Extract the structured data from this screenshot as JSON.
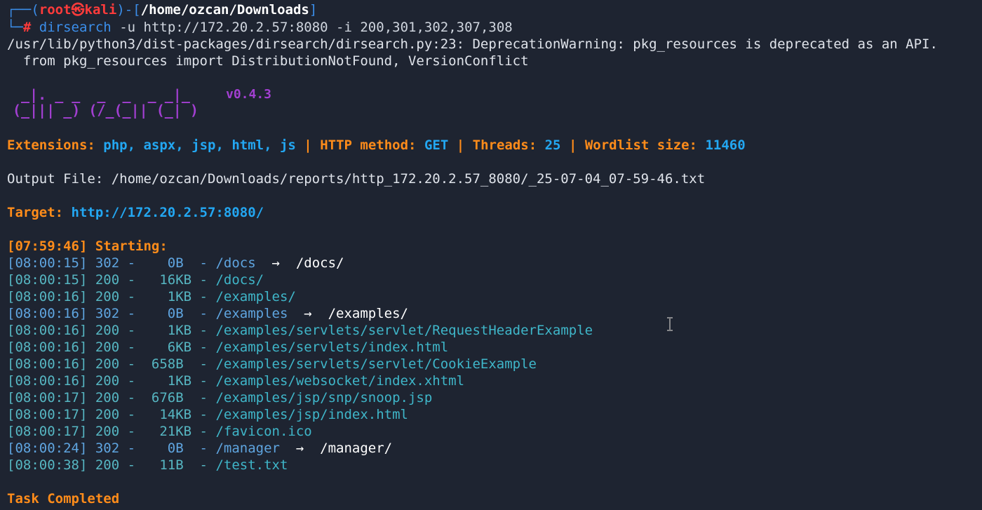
{
  "prompt": {
    "user": "root",
    "host": "kali",
    "cwd": "/home/ozcan/Downloads",
    "command": "dirsearch",
    "args": "-u http://172.20.2.57:8080 -i 200,301,302,307,308"
  },
  "warning": {
    "line1": "/usr/lib/python3/dist-packages/dirsearch/dirsearch.py:23: DeprecationWarning: pkg_resources is deprecated as an API.",
    "line2": "  from pkg_resources import DistributionNotFound, VersionConflict"
  },
  "banner": {
    "logo_line1": " _|. _ _  _  _  _ _|_",
    "logo_line2": "(_||| _) (/_(_|| (_| )",
    "version": "v0.4.3"
  },
  "config": {
    "ext_label": "Extensions:",
    "ext_value": "php, aspx, jsp, html, js",
    "method_label": "HTTP method:",
    "method_value": "GET",
    "threads_label": "Threads:",
    "threads_value": "25",
    "wordlist_label": "Wordlist size:",
    "wordlist_value": "11460",
    "sep": "|"
  },
  "output_file": "Output File: /home/ozcan/Downloads/reports/http_172.20.2.57_8080/_25-07-04_07-59-46.txt",
  "target": {
    "label": "Target:",
    "url": "http://172.20.2.57:8080/"
  },
  "start": {
    "time": "[07:59:46]",
    "label": "Starting:"
  },
  "results": [
    {
      "time": "[08:00:15]",
      "status": "302 -    0B  - ",
      "path": "/docs",
      "redirect": "  →  /docs/"
    },
    {
      "time": "[08:00:15]",
      "status": "200 -   16KB - ",
      "path": "/docs/",
      "redirect": ""
    },
    {
      "time": "[08:00:16]",
      "status": "200 -    1KB - ",
      "path": "/examples/",
      "redirect": ""
    },
    {
      "time": "[08:00:16]",
      "status": "302 -    0B  - ",
      "path": "/examples",
      "redirect": "  →  /examples/"
    },
    {
      "time": "[08:00:16]",
      "status": "200 -    1KB - ",
      "path": "/examples/servlets/servlet/RequestHeaderExample",
      "redirect": ""
    },
    {
      "time": "[08:00:16]",
      "status": "200 -    6KB - ",
      "path": "/examples/servlets/index.html",
      "redirect": ""
    },
    {
      "time": "[08:00:16]",
      "status": "200 -  658B  - ",
      "path": "/examples/servlets/servlet/CookieExample",
      "redirect": ""
    },
    {
      "time": "[08:00:16]",
      "status": "200 -    1KB - ",
      "path": "/examples/websocket/index.xhtml",
      "redirect": ""
    },
    {
      "time": "[08:00:17]",
      "status": "200 -  676B  - ",
      "path": "/examples/jsp/snp/snoop.jsp",
      "redirect": ""
    },
    {
      "time": "[08:00:17]",
      "status": "200 -   14KB - ",
      "path": "/examples/jsp/index.html",
      "redirect": ""
    },
    {
      "time": "[08:00:17]",
      "status": "200 -   21KB - ",
      "path": "/favicon.ico",
      "redirect": ""
    },
    {
      "time": "[08:00:24]",
      "status": "302 -    0B  - ",
      "path": "/manager",
      "redirect": "  →  /manager/"
    },
    {
      "time": "[08:00:38]",
      "status": "200 -   11B  - ",
      "path": "/test.txt",
      "redirect": ""
    }
  ],
  "done": "Task Completed",
  "colors": {
    "background": "#1e2431",
    "prompt_blue": "#3b8eea",
    "root_red": "#ff3b3b",
    "label_orange": "#ff8c1a",
    "value_blue": "#23a7f2",
    "logo_purple": "#a23fd1",
    "path_cyan": "#3fb6c9"
  }
}
